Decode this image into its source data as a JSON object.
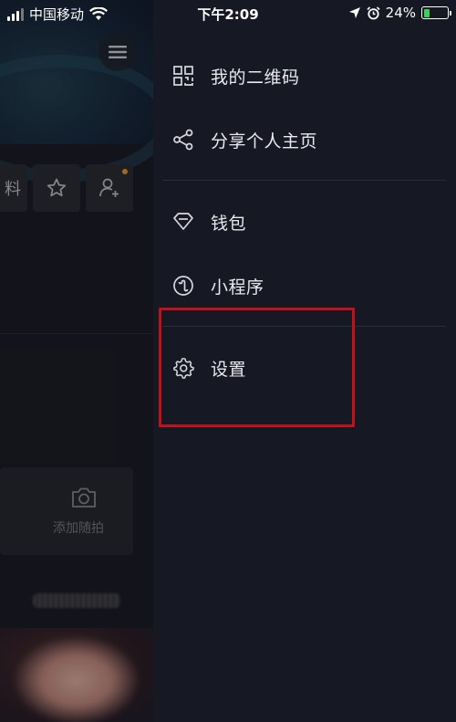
{
  "status_bar": {
    "carrier": "中国移动",
    "time": "下午2:09",
    "battery_percent": "24%",
    "battery_level": 0.24,
    "battery_color": "#3ad154"
  },
  "background_page": {
    "profile_button_partial_text": "料",
    "add_moment_label": "添加随拍"
  },
  "drawer": {
    "menu": [
      {
        "label": "我的二维码",
        "icon": "qr-code-icon"
      },
      {
        "label": "分享个人主页",
        "icon": "share-icon"
      },
      {
        "label": "钱包",
        "icon": "wallet-diamond-icon"
      },
      {
        "label": "小程序",
        "icon": "mini-program-icon"
      },
      {
        "label": "设置",
        "icon": "gear-icon"
      }
    ]
  },
  "colors": {
    "drawer_bg": "#161823",
    "highlight_border": "#c3111c",
    "notification_dot": "#f0a030"
  }
}
